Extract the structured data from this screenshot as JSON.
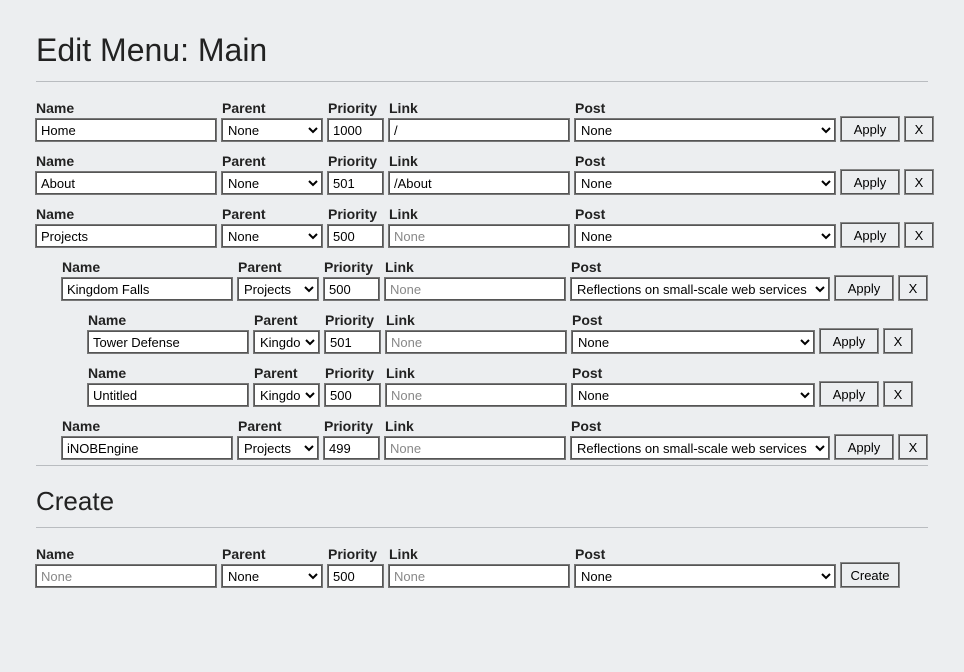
{
  "page": {
    "title": "Edit Menu: Main",
    "create_title": "Create"
  },
  "headers": {
    "name": "Name",
    "parent": "Parent",
    "priority": "Priority",
    "link": "Link",
    "post": "Post"
  },
  "placeholders": {
    "none": "None"
  },
  "buttons": {
    "apply": "Apply",
    "delete": "X",
    "create": "Create"
  },
  "rows": [
    {
      "name": "Home",
      "parent": "None",
      "priority": "1000",
      "link": "/",
      "post": "None",
      "indent": 0
    },
    {
      "name": "About",
      "parent": "None",
      "priority": "501",
      "link": "/About",
      "post": "None",
      "indent": 0
    },
    {
      "name": "Projects",
      "parent": "None",
      "priority": "500",
      "link": "",
      "post": "None",
      "indent": 0
    },
    {
      "name": "Kingdom Falls",
      "parent": "Projects",
      "priority": "500",
      "link": "",
      "post": "Reflections on small-scale web services",
      "indent": 1
    },
    {
      "name": "Tower Defense",
      "parent": "Kingdom Falls",
      "priority": "501",
      "link": "",
      "post": "None",
      "indent": 2
    },
    {
      "name": "Untitled",
      "parent": "Kingdom Falls",
      "priority": "500",
      "link": "",
      "post": "None",
      "indent": 2
    },
    {
      "name": "iNOBEngine",
      "parent": "Projects",
      "priority": "499",
      "link": "",
      "post": "Reflections on small-scale web services",
      "indent": 1
    }
  ],
  "create_row": {
    "name": "",
    "parent": "None",
    "priority": "500",
    "link": "",
    "post": "None"
  }
}
